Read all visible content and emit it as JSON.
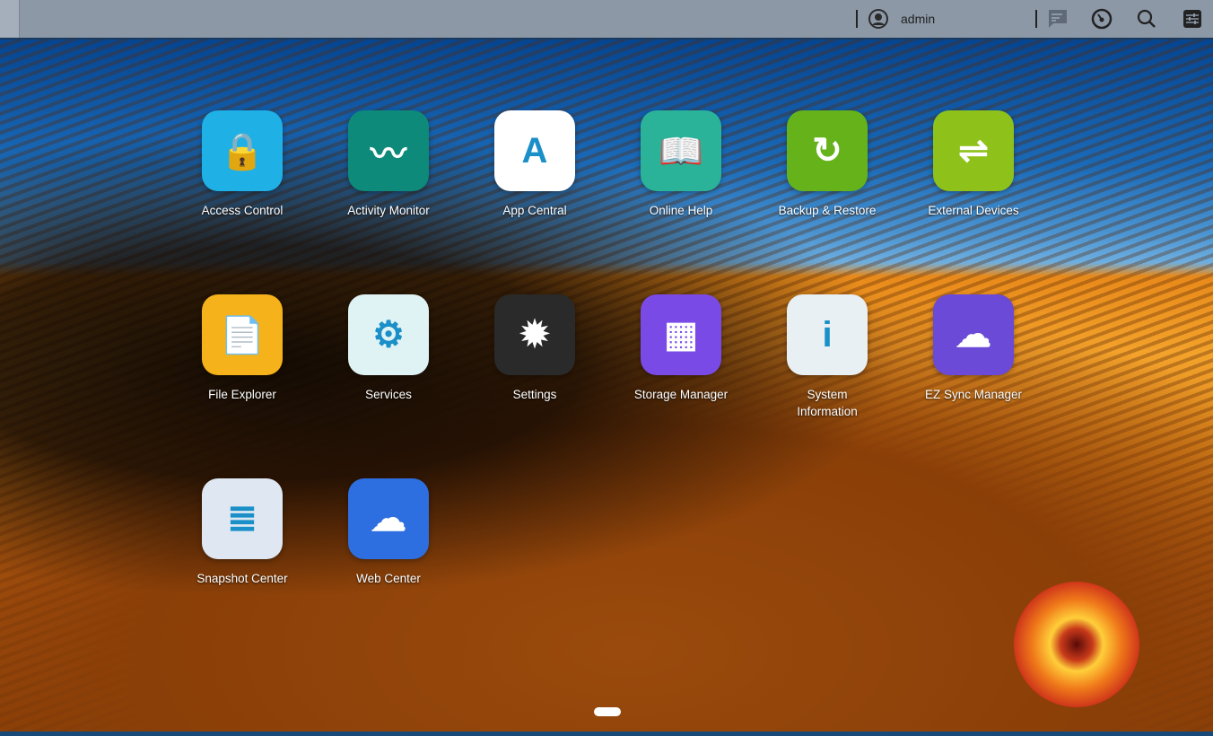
{
  "topbar": {
    "username": "admin",
    "icons": [
      "user-icon",
      "notifications-icon",
      "dashboard-gauge-icon",
      "search-icon",
      "settings-sliders-icon"
    ]
  },
  "apps": [
    {
      "label": "Access Control",
      "color": "#1fb0e6"
    },
    {
      "label": "Activity Monitor",
      "color": "#0e8a7a"
    },
    {
      "label": "App Central",
      "color": "#ffffff"
    },
    {
      "label": "Online Help",
      "color": "#2bb39a"
    },
    {
      "label": "Backup & Restore",
      "color": "#66b21a"
    },
    {
      "label": "External Devices",
      "color": "#8ec21a"
    },
    {
      "label": "File Explorer",
      "color": "#f6b21a"
    },
    {
      "label": "Services",
      "color": "#dff3f4"
    },
    {
      "label": "Settings",
      "color": "#2a2a2a"
    },
    {
      "label": "Storage Manager",
      "color": "#7a4ae6"
    },
    {
      "label": "System Information",
      "color": "#e8f0f4"
    },
    {
      "label": "EZ Sync Manager",
      "color": "#6a4ad6"
    },
    {
      "label": "Snapshot Center",
      "color": "#dfe8f2"
    },
    {
      "label": "Web Center",
      "color": "#2d6fe0"
    }
  ]
}
